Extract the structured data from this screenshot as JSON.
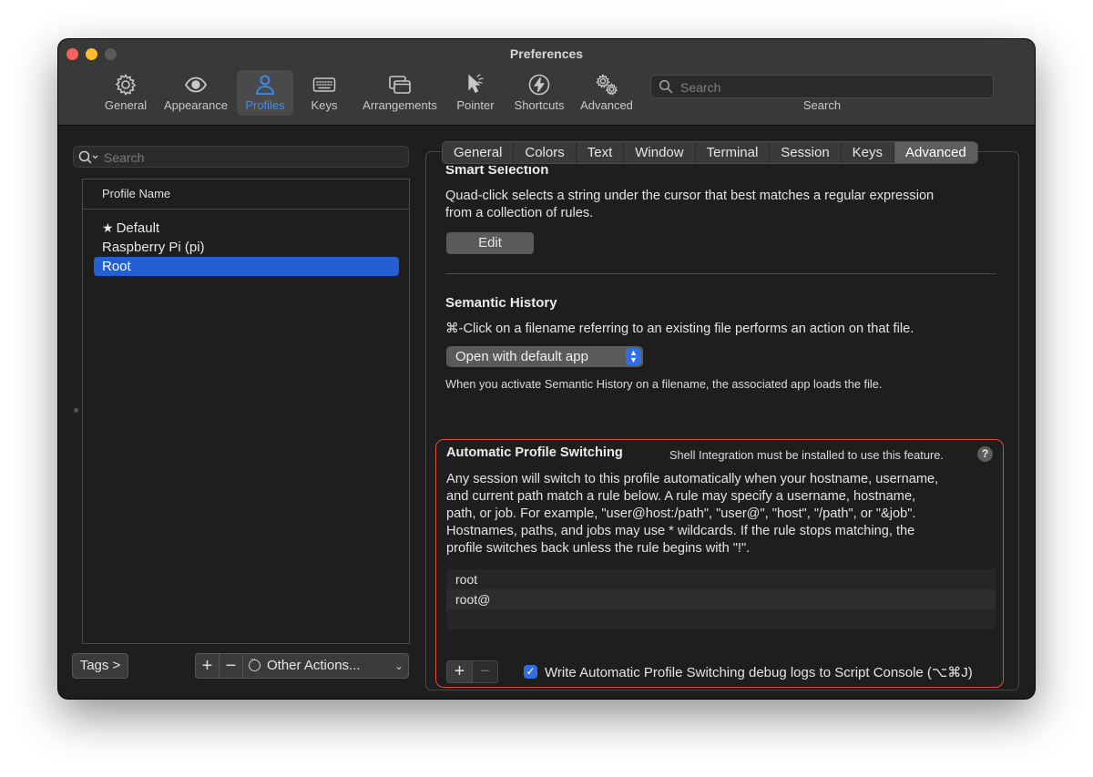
{
  "window": {
    "title": "Preferences"
  },
  "toolbar": {
    "items": [
      {
        "label": "General",
        "icon": "gear-icon"
      },
      {
        "label": "Appearance",
        "icon": "eye-icon"
      },
      {
        "label": "Profiles",
        "icon": "person-icon"
      },
      {
        "label": "Keys",
        "icon": "keyboard-icon"
      },
      {
        "label": "Arrangements",
        "icon": "windows-icon"
      },
      {
        "label": "Pointer",
        "icon": "pointer-icon"
      },
      {
        "label": "Shortcuts",
        "icon": "lightning-icon"
      },
      {
        "label": "Advanced",
        "icon": "gears-icon"
      }
    ],
    "active": "Profiles",
    "search_placeholder": "Search",
    "search_label": "Search"
  },
  "profiles": {
    "search_placeholder": "Search",
    "column_header": "Profile Name",
    "items": [
      {
        "name": "Default",
        "is_default": true
      },
      {
        "name": "Raspberry Pi (pi)",
        "is_default": false
      },
      {
        "name": "Root",
        "is_default": false
      }
    ],
    "selected": "Root",
    "tags_label": "Tags >",
    "add_glyph": "+",
    "remove_glyph": "−",
    "other_actions_label": "Other Actions..."
  },
  "tabs": {
    "items": [
      "General",
      "Colors",
      "Text",
      "Window",
      "Terminal",
      "Session",
      "Keys",
      "Advanced"
    ],
    "active": "Advanced"
  },
  "smart_selection": {
    "title": "Smart Selection",
    "description_line1": "Quad-click selects a string under the cursor that best matches a regular expression",
    "description_line2": "from a collection of rules.",
    "edit_label": "Edit"
  },
  "semantic_history": {
    "title": "Semantic History",
    "description": "⌘-Click on a filename referring to an existing file performs an action on that file.",
    "action_value": "Open with default app",
    "note": "When you activate Semantic History on a filename, the associated app loads the file."
  },
  "automatic_profile_switching": {
    "title": "Automatic Profile Switching",
    "requirement_note": "Shell Integration must be installed to use this feature.",
    "help_glyph": "?",
    "description_lines": [
      "Any session will switch to this profile automatically when your hostname, username,",
      "and current path match a rule below. A rule may specify a username, hostname,",
      "path, or job. For example, \"user@host:/path\", \"user@\", \"host\", \"/path\", or \"&job\".",
      "Hostnames, paths, and jobs may use * wildcards. If the rule stops matching, the",
      "profile switches back unless the rule begins with \"!\"."
    ],
    "rules": [
      "root",
      "root@",
      ""
    ],
    "add_glyph": "+",
    "remove_glyph": "−",
    "debug_logs_label": "Write Automatic Profile Switching debug logs to Script Console (⌥⌘J)",
    "debug_logs_checked": true
  },
  "colors": {
    "accent": "#2f6fe0",
    "selection": "#2260d4",
    "highlight_border": "#e24a3b"
  }
}
